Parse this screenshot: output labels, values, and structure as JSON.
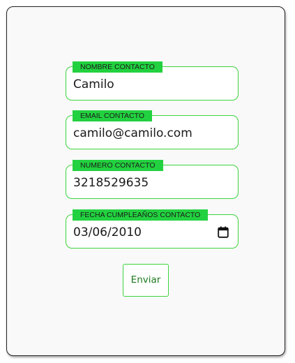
{
  "form": {
    "fields": [
      {
        "label": "NOMBRE CONTACTO",
        "value": "Camilo"
      },
      {
        "label": "EMAIL CONTACTO",
        "value": "camilo@camilo.com"
      },
      {
        "label": "NUMERO CONTACTO",
        "value": "3218529635"
      },
      {
        "label": "FECHA CUMPLEAÑOS CONTACTO",
        "value": "03/06/2010",
        "icon": "calendar-icon"
      }
    ],
    "submit_label": "Enviar"
  },
  "colors": {
    "accent_border": "#3cd43c",
    "label_background": "#22d13f",
    "button_text": "#1e7a1e"
  }
}
